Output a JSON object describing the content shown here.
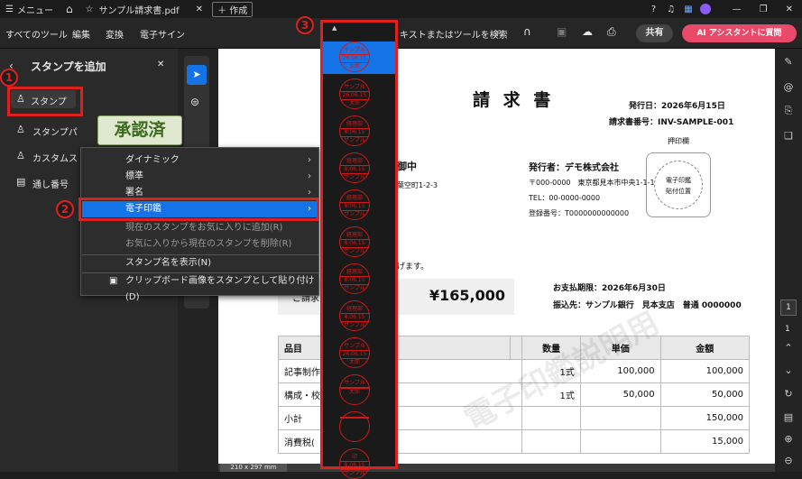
{
  "titlebar": {
    "menu": "メニュー",
    "tab_title": "サンプル請求書.pdf",
    "new_tab": "作成"
  },
  "toolbar": {
    "tabs": [
      "すべてのツール",
      "編集",
      "変換",
      "電子サイン"
    ],
    "search": "キストまたはツールを検索",
    "share": "共有",
    "ai": "AI アシスタントに質問"
  },
  "panel": {
    "title": "スタンプを追加",
    "items": [
      "スタンプ",
      "スタンプパ",
      "カスタムス",
      "通し番号"
    ]
  },
  "stamp_preview": "承認済",
  "context_menu": [
    "ダイナミック",
    "標準",
    "署名",
    "電子印鑑",
    "現在のスタンプをお気に入りに追加(R)",
    "お気に入りから現在のスタンプを削除(R)",
    "スタンプ名を表示(N)",
    "クリップボード画像をスタンプとして貼り付け(D)"
  ],
  "callouts": [
    "1",
    "2",
    "3"
  ],
  "stamps": [
    {
      "top": "サンプル",
      "mid": "26.06.15",
      "bot": "太郎"
    },
    {
      "top": "サンプル",
      "mid": "26.06.15",
      "bot": "太郎"
    },
    {
      "top": "経理部",
      "mid": "8.06.15",
      "bot": "サンプル"
    },
    {
      "top": "経理部",
      "mid": "8.06.15",
      "bot": "サンプル"
    },
    {
      "top": "経理部",
      "mid": "8.06.15",
      "bot": "サンプル"
    },
    {
      "top": "経理部",
      "mid": "8.06.15",
      "bot": "サンプル"
    },
    {
      "top": "経理部",
      "mid": "8.06.15",
      "bot": "サンプル"
    },
    {
      "top": "経理部",
      "mid": "8.06.15",
      "bot": "サンプル"
    },
    {
      "top": "サンプル",
      "mid": "26.06.15",
      "bot": "太郎"
    },
    {
      "top": "サンプル",
      "mid": "",
      "bot": "太郎"
    },
    {
      "top": "",
      "mid": "",
      "bot": ""
    },
    {
      "top": "印",
      "mid": "8.06.15",
      "bot": "サンプル"
    }
  ],
  "invoice": {
    "title": "請 求 書",
    "issue_date": "発行日：2026年6月15日",
    "invoice_no": "請求書番号：INV-SAMPLE-001",
    "seal_label": "押印欄",
    "seal_text": "電子印鑑\n貼付位置",
    "recipient": "御中",
    "recipient_addr": "葉空町1-2-3",
    "issuer": "発行者：デモ株式会社",
    "issuer_zip": "〒000-0000　東京都見本市中央1-1-1",
    "issuer_tel": "TEL：00-0000-0000",
    "issuer_reg": "登録番号：T0000000000000",
    "greeting": "げます。",
    "total_label": "ご請求",
    "total": "¥165,000",
    "due": "お支払期限：2026年6月30日",
    "bank": "振込先：サンプル銀行　見本支店　普通 0000000",
    "headers": [
      "品目",
      "",
      "数量",
      "単価",
      "金額"
    ],
    "rows": [
      [
        "記事制作",
        "1式",
        "100,000",
        "100,000"
      ],
      [
        "構成・校",
        "1式",
        "50,000",
        "50,000"
      ],
      [
        "小計",
        "",
        "",
        "150,000"
      ],
      [
        "消費税(",
        "",
        "",
        "15,000"
      ]
    ],
    "watermark": "電子印鑑説明用"
  },
  "page_size": "210 x 297 mm",
  "page_numbers": [
    "1",
    "1"
  ]
}
